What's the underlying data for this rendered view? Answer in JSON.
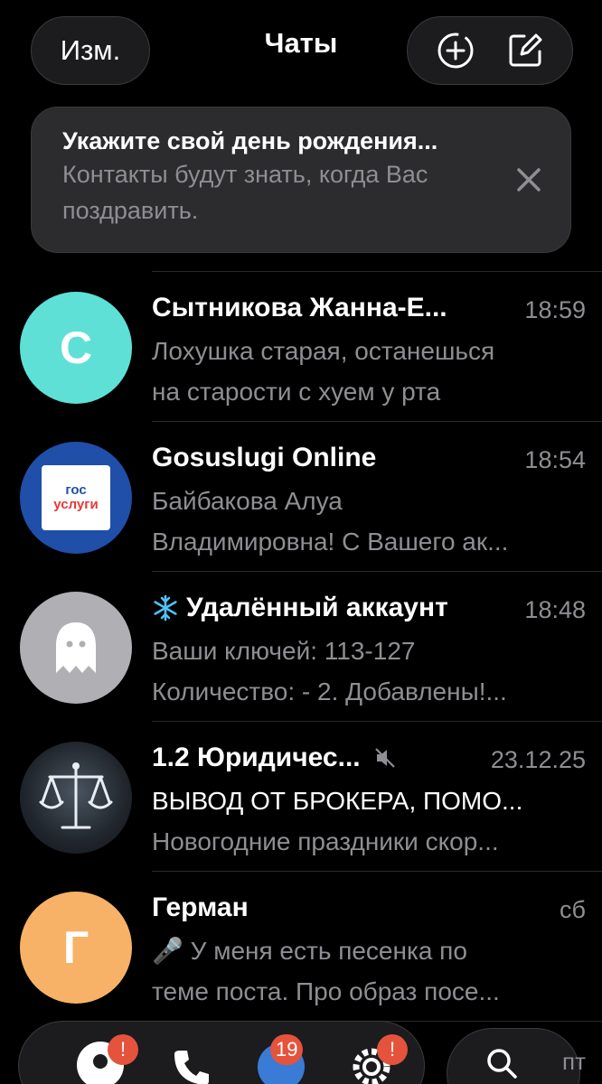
{
  "header": {
    "edit_label": "Изм.",
    "title": "Чаты"
  },
  "banner": {
    "title": "Укажите свой день рождения...",
    "text": "Контакты будут знать, когда Вас поздравить."
  },
  "chats": [
    {
      "name": "Сытникова Жанна-Е...",
      "time": "18:59",
      "line1": "Лохушка старая, останешься",
      "line2": "на старости с хуем у рта",
      "avatar_letter": "С",
      "avatar_color": "#5ee0d6"
    },
    {
      "name": "Gosuslugi Online",
      "time": "18:54",
      "line1": "Байбакова Алуа",
      "line2": "Владимировна! С Вашего ак...",
      "avatar_logo_top": "гос",
      "avatar_logo_bottom": "услуги",
      "avatar_color": "#1f4fa8"
    },
    {
      "name": "Удалённый аккаунт",
      "time": "18:48",
      "line1": "Ваши ключей: 113-127",
      "line2": "Количество: - 2. Добавлены!...",
      "avatar_icon": "ghost-icon",
      "avatar_color": "#b0b0b4",
      "prefix_icon": "snowflake-icon"
    },
    {
      "name": "1.2 Юридичес...",
      "time": "23.12.25",
      "line1": "ВЫВОД ОТ БРОКЕРА, ПОМО...",
      "line2": "Новогодние праздники скор...",
      "avatar_icon": "scales-icon",
      "muted_icon": "muted-icon"
    },
    {
      "name": "Герман",
      "time": "сб",
      "line1": "🎤 У меня есть песенка по",
      "line2": "теме поста. Про образ посе...",
      "avatar_letter": "Г",
      "avatar_color": "#f7b267"
    }
  ],
  "tabbar": {
    "badges": [
      "!",
      "19",
      "!"
    ]
  },
  "bottom_right_label": "пт"
}
